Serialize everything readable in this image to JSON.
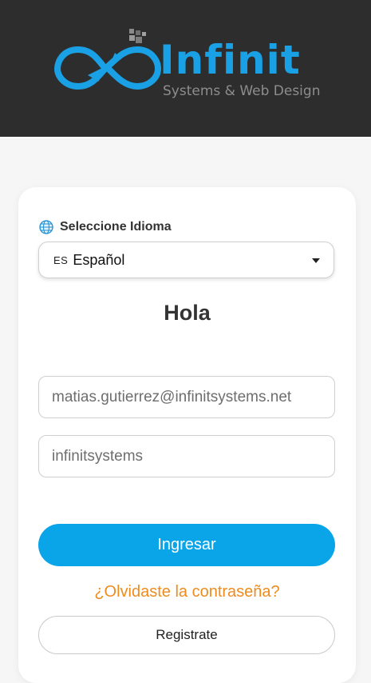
{
  "header": {
    "logo_name": "Infinit",
    "logo_tagline": "Systems & Web Design"
  },
  "language": {
    "label": "Seleccione Idioma",
    "selected_code": "ES",
    "selected_name": "Español",
    "icon": "globe-icon"
  },
  "login": {
    "greeting": "Hola",
    "email_value": "matias.gutierrez@infinitsystems.net",
    "password_value": "infinitsystems",
    "submit_label": "Ingresar",
    "forgot_label": "¿Olvidaste la contraseña?",
    "register_label": "Registrate"
  },
  "colors": {
    "header_bg": "#2d2d2d",
    "brand_blue": "#1aa0e4",
    "primary_button": "#0aa4e8",
    "link_orange": "#ee8c1e"
  }
}
